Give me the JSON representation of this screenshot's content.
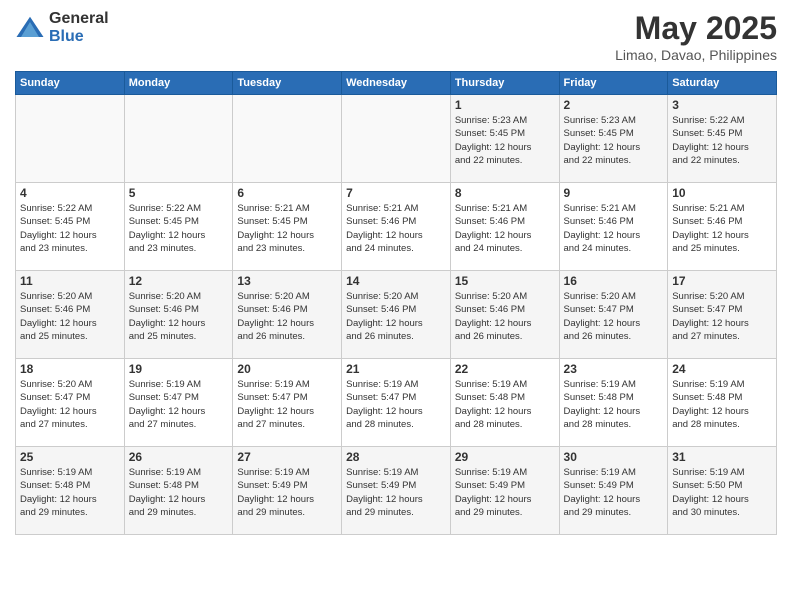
{
  "logo": {
    "general": "General",
    "blue": "Blue"
  },
  "title": "May 2025",
  "subtitle": "Limao, Davao, Philippines",
  "days_of_week": [
    "Sunday",
    "Monday",
    "Tuesday",
    "Wednesday",
    "Thursday",
    "Friday",
    "Saturday"
  ],
  "weeks": [
    [
      {
        "day": "",
        "info": ""
      },
      {
        "day": "",
        "info": ""
      },
      {
        "day": "",
        "info": ""
      },
      {
        "day": "",
        "info": ""
      },
      {
        "day": "1",
        "info": "Sunrise: 5:23 AM\nSunset: 5:45 PM\nDaylight: 12 hours\nand 22 minutes."
      },
      {
        "day": "2",
        "info": "Sunrise: 5:23 AM\nSunset: 5:45 PM\nDaylight: 12 hours\nand 22 minutes."
      },
      {
        "day": "3",
        "info": "Sunrise: 5:22 AM\nSunset: 5:45 PM\nDaylight: 12 hours\nand 22 minutes."
      }
    ],
    [
      {
        "day": "4",
        "info": "Sunrise: 5:22 AM\nSunset: 5:45 PM\nDaylight: 12 hours\nand 23 minutes."
      },
      {
        "day": "5",
        "info": "Sunrise: 5:22 AM\nSunset: 5:45 PM\nDaylight: 12 hours\nand 23 minutes."
      },
      {
        "day": "6",
        "info": "Sunrise: 5:21 AM\nSunset: 5:45 PM\nDaylight: 12 hours\nand 23 minutes."
      },
      {
        "day": "7",
        "info": "Sunrise: 5:21 AM\nSunset: 5:46 PM\nDaylight: 12 hours\nand 24 minutes."
      },
      {
        "day": "8",
        "info": "Sunrise: 5:21 AM\nSunset: 5:46 PM\nDaylight: 12 hours\nand 24 minutes."
      },
      {
        "day": "9",
        "info": "Sunrise: 5:21 AM\nSunset: 5:46 PM\nDaylight: 12 hours\nand 24 minutes."
      },
      {
        "day": "10",
        "info": "Sunrise: 5:21 AM\nSunset: 5:46 PM\nDaylight: 12 hours\nand 25 minutes."
      }
    ],
    [
      {
        "day": "11",
        "info": "Sunrise: 5:20 AM\nSunset: 5:46 PM\nDaylight: 12 hours\nand 25 minutes."
      },
      {
        "day": "12",
        "info": "Sunrise: 5:20 AM\nSunset: 5:46 PM\nDaylight: 12 hours\nand 25 minutes."
      },
      {
        "day": "13",
        "info": "Sunrise: 5:20 AM\nSunset: 5:46 PM\nDaylight: 12 hours\nand 26 minutes."
      },
      {
        "day": "14",
        "info": "Sunrise: 5:20 AM\nSunset: 5:46 PM\nDaylight: 12 hours\nand 26 minutes."
      },
      {
        "day": "15",
        "info": "Sunrise: 5:20 AM\nSunset: 5:46 PM\nDaylight: 12 hours\nand 26 minutes."
      },
      {
        "day": "16",
        "info": "Sunrise: 5:20 AM\nSunset: 5:47 PM\nDaylight: 12 hours\nand 26 minutes."
      },
      {
        "day": "17",
        "info": "Sunrise: 5:20 AM\nSunset: 5:47 PM\nDaylight: 12 hours\nand 27 minutes."
      }
    ],
    [
      {
        "day": "18",
        "info": "Sunrise: 5:20 AM\nSunset: 5:47 PM\nDaylight: 12 hours\nand 27 minutes."
      },
      {
        "day": "19",
        "info": "Sunrise: 5:19 AM\nSunset: 5:47 PM\nDaylight: 12 hours\nand 27 minutes."
      },
      {
        "day": "20",
        "info": "Sunrise: 5:19 AM\nSunset: 5:47 PM\nDaylight: 12 hours\nand 27 minutes."
      },
      {
        "day": "21",
        "info": "Sunrise: 5:19 AM\nSunset: 5:47 PM\nDaylight: 12 hours\nand 28 minutes."
      },
      {
        "day": "22",
        "info": "Sunrise: 5:19 AM\nSunset: 5:48 PM\nDaylight: 12 hours\nand 28 minutes."
      },
      {
        "day": "23",
        "info": "Sunrise: 5:19 AM\nSunset: 5:48 PM\nDaylight: 12 hours\nand 28 minutes."
      },
      {
        "day": "24",
        "info": "Sunrise: 5:19 AM\nSunset: 5:48 PM\nDaylight: 12 hours\nand 28 minutes."
      }
    ],
    [
      {
        "day": "25",
        "info": "Sunrise: 5:19 AM\nSunset: 5:48 PM\nDaylight: 12 hours\nand 29 minutes."
      },
      {
        "day": "26",
        "info": "Sunrise: 5:19 AM\nSunset: 5:48 PM\nDaylight: 12 hours\nand 29 minutes."
      },
      {
        "day": "27",
        "info": "Sunrise: 5:19 AM\nSunset: 5:49 PM\nDaylight: 12 hours\nand 29 minutes."
      },
      {
        "day": "28",
        "info": "Sunrise: 5:19 AM\nSunset: 5:49 PM\nDaylight: 12 hours\nand 29 minutes."
      },
      {
        "day": "29",
        "info": "Sunrise: 5:19 AM\nSunset: 5:49 PM\nDaylight: 12 hours\nand 29 minutes."
      },
      {
        "day": "30",
        "info": "Sunrise: 5:19 AM\nSunset: 5:49 PM\nDaylight: 12 hours\nand 29 minutes."
      },
      {
        "day": "31",
        "info": "Sunrise: 5:19 AM\nSunset: 5:50 PM\nDaylight: 12 hours\nand 30 minutes."
      }
    ]
  ]
}
